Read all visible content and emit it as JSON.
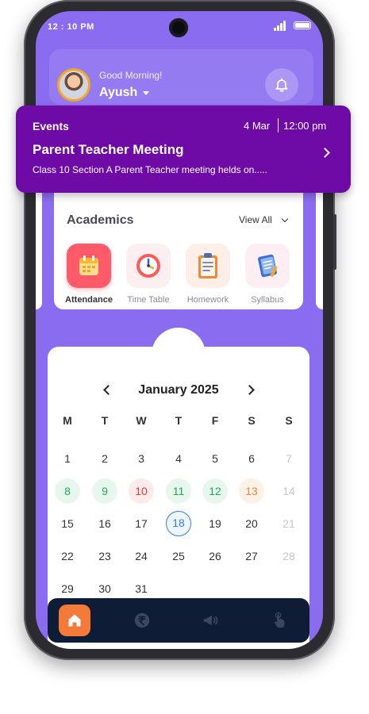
{
  "status_bar": {
    "time": "12 : 10 PM"
  },
  "header": {
    "greeting": "Good Morning!",
    "user_name": "Ayush"
  },
  "event": {
    "label": "Events",
    "date": "4 Mar",
    "time": "12:00 pm",
    "title": "Parent Teacher Meeting",
    "description": "Class 10 Section A Parent Teacher meeting helds on....."
  },
  "academics": {
    "title": "Academics",
    "view_all": "View All",
    "items": [
      {
        "label": "Attendance",
        "icon": "calendar-icon",
        "active": true
      },
      {
        "label": "Time Table",
        "icon": "clock-icon",
        "active": false
      },
      {
        "label": "Homework",
        "icon": "clipboard-icon",
        "active": false
      },
      {
        "label": "Syllabus",
        "icon": "notebook-icon",
        "active": false
      }
    ]
  },
  "calendar": {
    "month_label": "January 2025",
    "weekdays": [
      "M",
      "T",
      "W",
      "T",
      "F",
      "S",
      "S"
    ],
    "weeks": [
      [
        "1",
        "2",
        "3",
        "4",
        "5",
        "6",
        "7"
      ],
      [
        "8",
        "9",
        "10",
        "11",
        "12",
        "13",
        "14"
      ],
      [
        "15",
        "16",
        "17",
        "18",
        "19",
        "20",
        "21"
      ],
      [
        "22",
        "23",
        "24",
        "25",
        "26",
        "27",
        "28"
      ],
      [
        "29",
        "30",
        "31",
        "",
        "",
        "",
        ""
      ]
    ],
    "status_colors": {
      "present": "#22a85a",
      "absent": "#e03b3b",
      "late": "#e2874a",
      "today": "#2f7fdd"
    }
  },
  "bottom_nav": [
    {
      "name": "home",
      "icon": "home-icon",
      "active": true
    },
    {
      "name": "fees",
      "icon": "rupee-icon",
      "active": false
    },
    {
      "name": "announcements",
      "icon": "megaphone-icon",
      "active": false
    },
    {
      "name": "touch",
      "icon": "hand-tap-icon",
      "active": false
    }
  ],
  "colors": {
    "primary": "#8a6cf0",
    "event_banner": "#6e0aa6",
    "nav_bg": "#0f1c35",
    "accent": "#f47a3a"
  }
}
